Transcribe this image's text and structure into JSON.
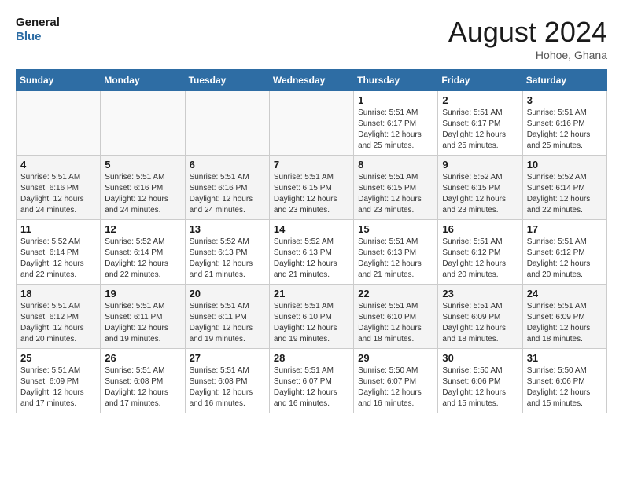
{
  "header": {
    "logo_line1": "General",
    "logo_line2": "Blue",
    "month_year": "August 2024",
    "location": "Hohoe, Ghana"
  },
  "days_of_week": [
    "Sunday",
    "Monday",
    "Tuesday",
    "Wednesday",
    "Thursday",
    "Friday",
    "Saturday"
  ],
  "weeks": [
    {
      "days": [
        {
          "num": "",
          "info": ""
        },
        {
          "num": "",
          "info": ""
        },
        {
          "num": "",
          "info": ""
        },
        {
          "num": "",
          "info": ""
        },
        {
          "num": "1",
          "info": "Sunrise: 5:51 AM\nSunset: 6:17 PM\nDaylight: 12 hours\nand 25 minutes."
        },
        {
          "num": "2",
          "info": "Sunrise: 5:51 AM\nSunset: 6:17 PM\nDaylight: 12 hours\nand 25 minutes."
        },
        {
          "num": "3",
          "info": "Sunrise: 5:51 AM\nSunset: 6:16 PM\nDaylight: 12 hours\nand 25 minutes."
        }
      ]
    },
    {
      "days": [
        {
          "num": "4",
          "info": "Sunrise: 5:51 AM\nSunset: 6:16 PM\nDaylight: 12 hours\nand 24 minutes."
        },
        {
          "num": "5",
          "info": "Sunrise: 5:51 AM\nSunset: 6:16 PM\nDaylight: 12 hours\nand 24 minutes."
        },
        {
          "num": "6",
          "info": "Sunrise: 5:51 AM\nSunset: 6:16 PM\nDaylight: 12 hours\nand 24 minutes."
        },
        {
          "num": "7",
          "info": "Sunrise: 5:51 AM\nSunset: 6:15 PM\nDaylight: 12 hours\nand 23 minutes."
        },
        {
          "num": "8",
          "info": "Sunrise: 5:51 AM\nSunset: 6:15 PM\nDaylight: 12 hours\nand 23 minutes."
        },
        {
          "num": "9",
          "info": "Sunrise: 5:52 AM\nSunset: 6:15 PM\nDaylight: 12 hours\nand 23 minutes."
        },
        {
          "num": "10",
          "info": "Sunrise: 5:52 AM\nSunset: 6:14 PM\nDaylight: 12 hours\nand 22 minutes."
        }
      ]
    },
    {
      "days": [
        {
          "num": "11",
          "info": "Sunrise: 5:52 AM\nSunset: 6:14 PM\nDaylight: 12 hours\nand 22 minutes."
        },
        {
          "num": "12",
          "info": "Sunrise: 5:52 AM\nSunset: 6:14 PM\nDaylight: 12 hours\nand 22 minutes."
        },
        {
          "num": "13",
          "info": "Sunrise: 5:52 AM\nSunset: 6:13 PM\nDaylight: 12 hours\nand 21 minutes."
        },
        {
          "num": "14",
          "info": "Sunrise: 5:52 AM\nSunset: 6:13 PM\nDaylight: 12 hours\nand 21 minutes."
        },
        {
          "num": "15",
          "info": "Sunrise: 5:51 AM\nSunset: 6:13 PM\nDaylight: 12 hours\nand 21 minutes."
        },
        {
          "num": "16",
          "info": "Sunrise: 5:51 AM\nSunset: 6:12 PM\nDaylight: 12 hours\nand 20 minutes."
        },
        {
          "num": "17",
          "info": "Sunrise: 5:51 AM\nSunset: 6:12 PM\nDaylight: 12 hours\nand 20 minutes."
        }
      ]
    },
    {
      "days": [
        {
          "num": "18",
          "info": "Sunrise: 5:51 AM\nSunset: 6:12 PM\nDaylight: 12 hours\nand 20 minutes."
        },
        {
          "num": "19",
          "info": "Sunrise: 5:51 AM\nSunset: 6:11 PM\nDaylight: 12 hours\nand 19 minutes."
        },
        {
          "num": "20",
          "info": "Sunrise: 5:51 AM\nSunset: 6:11 PM\nDaylight: 12 hours\nand 19 minutes."
        },
        {
          "num": "21",
          "info": "Sunrise: 5:51 AM\nSunset: 6:10 PM\nDaylight: 12 hours\nand 19 minutes."
        },
        {
          "num": "22",
          "info": "Sunrise: 5:51 AM\nSunset: 6:10 PM\nDaylight: 12 hours\nand 18 minutes."
        },
        {
          "num": "23",
          "info": "Sunrise: 5:51 AM\nSunset: 6:09 PM\nDaylight: 12 hours\nand 18 minutes."
        },
        {
          "num": "24",
          "info": "Sunrise: 5:51 AM\nSunset: 6:09 PM\nDaylight: 12 hours\nand 18 minutes."
        }
      ]
    },
    {
      "days": [
        {
          "num": "25",
          "info": "Sunrise: 5:51 AM\nSunset: 6:09 PM\nDaylight: 12 hours\nand 17 minutes."
        },
        {
          "num": "26",
          "info": "Sunrise: 5:51 AM\nSunset: 6:08 PM\nDaylight: 12 hours\nand 17 minutes."
        },
        {
          "num": "27",
          "info": "Sunrise: 5:51 AM\nSunset: 6:08 PM\nDaylight: 12 hours\nand 16 minutes."
        },
        {
          "num": "28",
          "info": "Sunrise: 5:51 AM\nSunset: 6:07 PM\nDaylight: 12 hours\nand 16 minutes."
        },
        {
          "num": "29",
          "info": "Sunrise: 5:50 AM\nSunset: 6:07 PM\nDaylight: 12 hours\nand 16 minutes."
        },
        {
          "num": "30",
          "info": "Sunrise: 5:50 AM\nSunset: 6:06 PM\nDaylight: 12 hours\nand 15 minutes."
        },
        {
          "num": "31",
          "info": "Sunrise: 5:50 AM\nSunset: 6:06 PM\nDaylight: 12 hours\nand 15 minutes."
        }
      ]
    }
  ]
}
